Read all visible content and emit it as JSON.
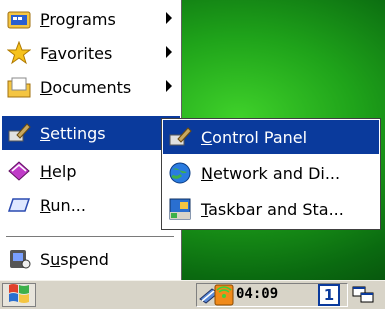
{
  "start_menu": {
    "items": [
      {
        "pre": "",
        "ul": "P",
        "post": "rograms",
        "icon": "programs-folder-icon",
        "submenu": true
      },
      {
        "pre": "F",
        "ul": "a",
        "post": "vorites",
        "icon": "favorites-star-icon",
        "submenu": true
      },
      {
        "pre": "",
        "ul": "D",
        "post": "ocuments",
        "icon": "documents-folder-icon",
        "submenu": true
      },
      {
        "pre": "",
        "ul": "S",
        "post": "ettings",
        "icon": "settings-icon",
        "submenu": true,
        "selected": true
      },
      {
        "pre": "",
        "ul": "H",
        "post": "elp",
        "icon": "help-book-icon"
      },
      {
        "pre": "",
        "ul": "R",
        "post": "un...",
        "icon": "run-icon"
      },
      {
        "pre": "S",
        "ul": "u",
        "post": "spend",
        "icon": "suspend-icon"
      }
    ]
  },
  "settings_submenu": {
    "items": [
      {
        "pre": "",
        "ul": "C",
        "post": "ontrol Panel",
        "icon": "control-panel-icon",
        "selected": true
      },
      {
        "pre": "",
        "ul": "N",
        "post": "etwork and Di...",
        "icon": "network-globe-icon"
      },
      {
        "pre": "",
        "ul": "T",
        "post": "askbar and Sta...",
        "icon": "taskbar-icon"
      }
    ]
  },
  "taskbar": {
    "clock": "04:09",
    "input_number": "1"
  },
  "colors": {
    "selection": "#0a3a9c",
    "desktop_green": "#1fa31a"
  }
}
